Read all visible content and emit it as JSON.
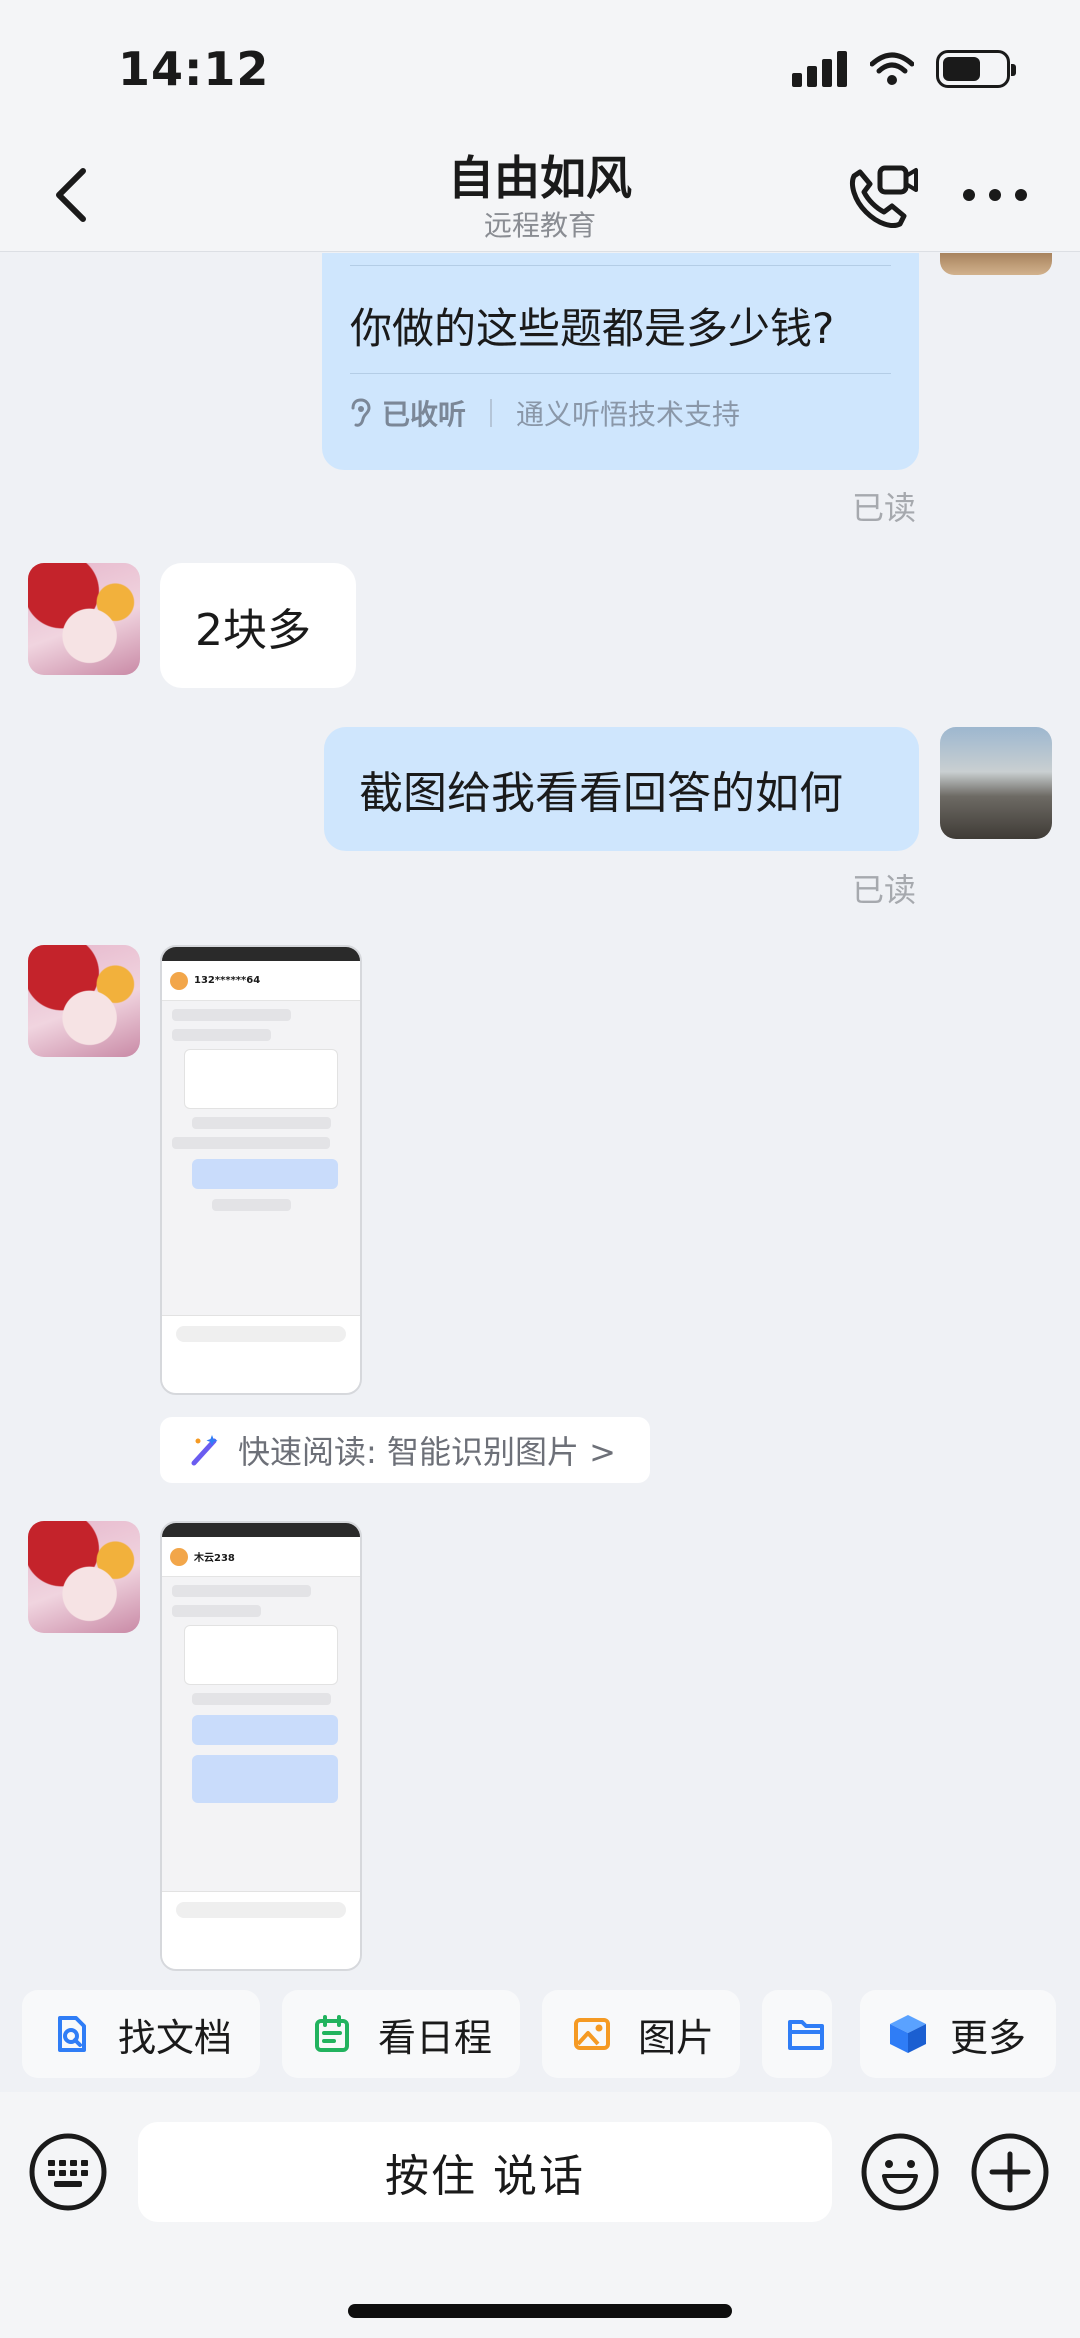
{
  "status_bar": {
    "time": "14:12"
  },
  "header": {
    "title": "自由如风",
    "subtitle": "远程教育"
  },
  "messages": {
    "voice_text": "你做的这些题都是多少钱?",
    "voice_heard": "已收听",
    "voice_support": "通义听悟技术支持",
    "read_label": "已读",
    "reply_price": "2块多",
    "request_screenshot": "截图给我看看回答的如何",
    "screenshot1_name": "132******64",
    "screenshot2_name": "木云238",
    "quick_read": "快速阅读: 智能识别图片 >"
  },
  "quick_actions": [
    {
      "label": "找文档",
      "icon": "doc-search-icon",
      "color": "#2f7df6"
    },
    {
      "label": "看日程",
      "icon": "calendar-icon",
      "color": "#22b35e"
    },
    {
      "label": "图片",
      "icon": "image-icon",
      "color": "#f59a23"
    },
    {
      "label": "",
      "icon": "folder-icon",
      "color": "#2f7df6"
    },
    {
      "label": "更多",
      "icon": "cube-icon",
      "color": "#2f7df6"
    }
  ],
  "input": {
    "talk_label": "按住 说话"
  }
}
